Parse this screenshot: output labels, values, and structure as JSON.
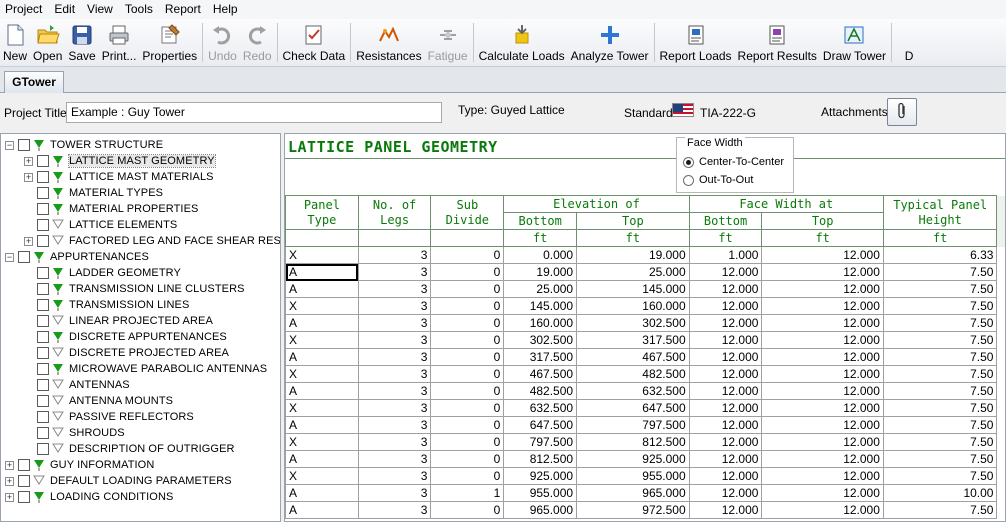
{
  "menu": [
    "Project",
    "Edit",
    "View",
    "Tools",
    "Report",
    "Help"
  ],
  "toolbar": [
    {
      "label": "New",
      "icon": "new-file-icon",
      "disabled": false
    },
    {
      "label": "Open",
      "icon": "open-folder-icon",
      "disabled": false
    },
    {
      "label": "Save",
      "icon": "save-disk-icon",
      "disabled": false
    },
    {
      "label": "Print...",
      "icon": "printer-icon",
      "disabled": false
    },
    {
      "label": "Properties",
      "icon": "properties-icon",
      "disabled": false
    },
    {
      "label": "Undo",
      "icon": "undo-icon",
      "disabled": true
    },
    {
      "label": "Redo",
      "icon": "redo-icon",
      "disabled": true
    },
    {
      "label": "Check Data",
      "icon": "check-data-icon",
      "disabled": false
    },
    {
      "label": "Resistances",
      "icon": "resistances-icon",
      "disabled": false
    },
    {
      "label": "Fatigue",
      "icon": "fatigue-icon",
      "disabled": true
    },
    {
      "label": "Calculate Loads",
      "icon": "calculate-loads-icon",
      "disabled": false
    },
    {
      "label": "Analyze Tower",
      "icon": "analyze-tower-icon",
      "disabled": false
    },
    {
      "label": "Report Loads",
      "icon": "report-loads-icon",
      "disabled": false
    },
    {
      "label": "Report Results",
      "icon": "report-results-icon",
      "disabled": false
    },
    {
      "label": "Draw Tower",
      "icon": "draw-tower-icon",
      "disabled": false
    },
    {
      "label": "D",
      "icon": "more-icon",
      "disabled": false
    }
  ],
  "tab": "GTower",
  "project": {
    "title_label": "Project Title:",
    "title_value": "Example : Guy Tower",
    "type_label": "Type: Guyed Lattice",
    "standard_label": "Standard:",
    "standard_value": "TIA-222-G",
    "attachments_label": "Attachments:"
  },
  "tree": [
    {
      "label": "TOWER STRUCTURE",
      "level": 0,
      "expander": "minus",
      "flag": "green"
    },
    {
      "label": "LATTICE MAST GEOMETRY",
      "level": 1,
      "expander": "plus",
      "flag": "green",
      "selected": true
    },
    {
      "label": "LATTICE MAST MATERIALS",
      "level": 1,
      "expander": "plus",
      "flag": "green"
    },
    {
      "label": "MATERIAL TYPES",
      "level": 1,
      "expander": "none",
      "flag": "green"
    },
    {
      "label": "MATERIAL PROPERTIES",
      "level": 1,
      "expander": "none",
      "flag": "green"
    },
    {
      "label": "LATTICE ELEMENTS",
      "level": 1,
      "expander": "none",
      "flag": "empty"
    },
    {
      "label": "FACTORED LEG AND FACE SHEAR RESIS",
      "level": 1,
      "expander": "plus",
      "flag": "empty"
    },
    {
      "label": "APPURTENANCES",
      "level": 0,
      "expander": "minus",
      "flag": "green"
    },
    {
      "label": "LADDER GEOMETRY",
      "level": 1,
      "expander": "none",
      "flag": "green"
    },
    {
      "label": "TRANSMISSION LINE CLUSTERS",
      "level": 1,
      "expander": "none",
      "flag": "green"
    },
    {
      "label": "TRANSMISSION LINES",
      "level": 1,
      "expander": "none",
      "flag": "green"
    },
    {
      "label": "LINEAR PROJECTED AREA",
      "level": 1,
      "expander": "none",
      "flag": "empty"
    },
    {
      "label": "DISCRETE APPURTENANCES",
      "level": 1,
      "expander": "none",
      "flag": "green"
    },
    {
      "label": "DISCRETE PROJECTED AREA",
      "level": 1,
      "expander": "none",
      "flag": "empty"
    },
    {
      "label": "MICROWAVE PARABOLIC ANTENNAS",
      "level": 1,
      "expander": "none",
      "flag": "green"
    },
    {
      "label": "ANTENNAS",
      "level": 1,
      "expander": "none",
      "flag": "empty"
    },
    {
      "label": "ANTENNA MOUNTS",
      "level": 1,
      "expander": "none",
      "flag": "empty"
    },
    {
      "label": "PASSIVE REFLECTORS",
      "level": 1,
      "expander": "none",
      "flag": "empty"
    },
    {
      "label": "SHROUDS",
      "level": 1,
      "expander": "none",
      "flag": "empty"
    },
    {
      "label": "DESCRIPTION OF OUTRIGGER",
      "level": 1,
      "expander": "none",
      "flag": "empty"
    },
    {
      "label": "GUY INFORMATION",
      "level": 0,
      "expander": "plus",
      "flag": "green"
    },
    {
      "label": "DEFAULT LOADING PARAMETERS",
      "level": 0,
      "expander": "plus",
      "flag": "empty"
    },
    {
      "label": "LOADING CONDITIONS",
      "level": 0,
      "expander": "plus",
      "flag": "green"
    }
  ],
  "grid": {
    "title": "LATTICE PANEL GEOMETRY",
    "face_width": {
      "legend": "Face Width",
      "options": [
        "Center-To-Center",
        "Out-To-Out"
      ],
      "selected": "Center-To-Center"
    },
    "headers": {
      "panel_type": [
        "Panel",
        "Type"
      ],
      "legs": [
        "No. of",
        "Legs"
      ],
      "sub_divide": [
        "Sub",
        "Divide"
      ],
      "elevation": "Elevation of",
      "face_width_at": "Face Width at",
      "typical": [
        "Typical Panel",
        "Height"
      ],
      "bottom": "Bottom",
      "top": "Top",
      "unit": "ft"
    },
    "rows": [
      [
        "X",
        "3",
        "0",
        "0.000",
        "19.000",
        "1.000",
        "12.000",
        "6.33"
      ],
      [
        "A",
        "3",
        "0",
        "19.000",
        "25.000",
        "12.000",
        "12.000",
        "7.50"
      ],
      [
        "A",
        "3",
        "0",
        "25.000",
        "145.000",
        "12.000",
        "12.000",
        "7.50"
      ],
      [
        "X",
        "3",
        "0",
        "145.000",
        "160.000",
        "12.000",
        "12.000",
        "7.50"
      ],
      [
        "A",
        "3",
        "0",
        "160.000",
        "302.500",
        "12.000",
        "12.000",
        "7.50"
      ],
      [
        "X",
        "3",
        "0",
        "302.500",
        "317.500",
        "12.000",
        "12.000",
        "7.50"
      ],
      [
        "A",
        "3",
        "0",
        "317.500",
        "467.500",
        "12.000",
        "12.000",
        "7.50"
      ],
      [
        "X",
        "3",
        "0",
        "467.500",
        "482.500",
        "12.000",
        "12.000",
        "7.50"
      ],
      [
        "A",
        "3",
        "0",
        "482.500",
        "632.500",
        "12.000",
        "12.000",
        "7.50"
      ],
      [
        "X",
        "3",
        "0",
        "632.500",
        "647.500",
        "12.000",
        "12.000",
        "7.50"
      ],
      [
        "A",
        "3",
        "0",
        "647.500",
        "797.500",
        "12.000",
        "12.000",
        "7.50"
      ],
      [
        "X",
        "3",
        "0",
        "797.500",
        "812.500",
        "12.000",
        "12.000",
        "7.50"
      ],
      [
        "A",
        "3",
        "0",
        "812.500",
        "925.000",
        "12.000",
        "12.000",
        "7.50"
      ],
      [
        "X",
        "3",
        "0",
        "925.000",
        "955.000",
        "12.000",
        "12.000",
        "7.50"
      ],
      [
        "A",
        "3",
        "1",
        "955.000",
        "965.000",
        "12.000",
        "12.000",
        "10.00"
      ],
      [
        "A",
        "3",
        "0",
        "965.000",
        "972.500",
        "12.000",
        "12.000",
        "7.50"
      ]
    ]
  },
  "colors": {
    "accent_green": "#0a7a0a",
    "flag_green": "#1a9a1a"
  }
}
